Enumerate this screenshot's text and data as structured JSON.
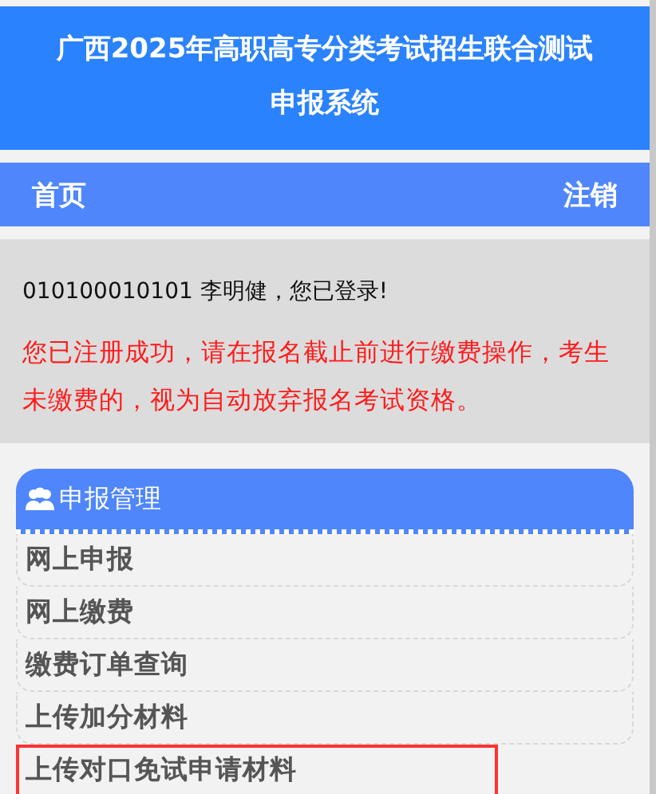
{
  "header": {
    "title_lines": [
      "广西2025年高职高专分类考试招生联合测试",
      "申报系统"
    ]
  },
  "nav": {
    "left": "首页",
    "right": "注销"
  },
  "welcome": {
    "text": "010100010101 李明健，您已登录!",
    "notice": "您已注册成功，请在报名截止前进行缴费操作，考生未缴费的，视为自动放弃报名考试资格。"
  },
  "panel": {
    "title": "申报管理",
    "items": [
      {
        "label": "网上申报",
        "highlighted": false
      },
      {
        "label": "网上缴费",
        "highlighted": false
      },
      {
        "label": "缴费订单查询",
        "highlighted": false
      },
      {
        "label": "上传加分材料",
        "highlighted": false
      },
      {
        "label": "上传对口免试申请材料",
        "highlighted": true
      }
    ]
  }
}
